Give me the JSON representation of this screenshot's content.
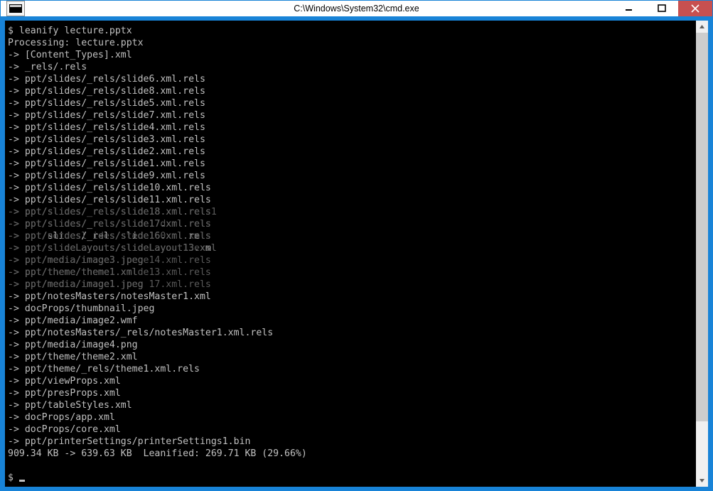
{
  "window": {
    "title": "C:\\Windows\\System32\\cmd.exe"
  },
  "terminal": {
    "command": "$ leanify lecture.pptx",
    "processing": "Processing: lecture.pptx",
    "lines": [
      "-> [Content_Types].xml",
      "-> _rels/.rels",
      "-> ppt/slides/_rels/slide6.xml.rels",
      "-> ppt/slides/_rels/slide8.xml.rels",
      "-> ppt/slides/_rels/slide5.xml.rels",
      "-> ppt/slides/_rels/slide7.xml.rels",
      "-> ppt/slides/_rels/slide4.xml.rels",
      "-> ppt/slides/_rels/slide3.xml.rels",
      "-> ppt/slides/_rels/slide2.xml.rels",
      "-> ppt/slides/_rels/slide1.xml.rels",
      "-> ppt/slides/_rels/slide9.xml.rels",
      "-> ppt/slides/_rels/slide10.xml.rels",
      "-> ppt/slides/_rels/slide11.xml.rels"
    ],
    "overlap": [
      {
        "front": "-> ppt/slides/_rels/slide18.xml.rels",
        "ghost": "-> ppt/slides/_rels/slide18.xml.rels1"
      },
      {
        "front": "-> ppt/slides/_rels/slide17.xml.rels",
        "ghost": "-> ppt/slides/ rels/slide17dxml.rels"
      },
      {
        "front": "-> ppt/slides/_rels/slide16.xml.rels",
        "ghost": "-> ppt/notdesl ides/stede160xml.xmls"
      },
      {
        "front": "-> ppt/slideLayouts/slideLayout13.xml",
        "ghost": "-> ppt/slideLayouts/slideLayout13exsl"
      },
      {
        "front": "-> ppt/media/image3.jpeg",
        "ghost": "-> ppt/media/image3.jpege14.xml.rels"
      },
      {
        "front": "-> ppt/theme/theme1.xml",
        "ghost": "-> ppt/theme/theme1.xmlde13.xml.rels"
      },
      {
        "front": "-> ppt/media/image1.jpeg",
        "ghost": "-> ppt/media/image1.jpeg 17.xml.rels"
      }
    ],
    "lines2": [
      "-> ppt/notesMasters/notesMaster1.xml",
      "-> docProps/thumbnail.jpeg",
      "-> ppt/media/image2.wmf",
      "-> ppt/notesMasters/_rels/notesMaster1.xml.rels",
      "-> ppt/media/image4.png",
      "-> ppt/theme/theme2.xml",
      "-> ppt/theme/_rels/theme1.xml.rels",
      "-> ppt/viewProps.xml",
      "-> ppt/presProps.xml",
      "-> ppt/tableStyles.xml",
      "-> docProps/app.xml",
      "-> docProps/core.xml",
      "-> ppt/printerSettings/printerSettings1.bin"
    ],
    "summary": "909.34 KB -> 639.63 KB  Leanified: 269.71 KB (29.66%)",
    "prompt": "$ "
  }
}
